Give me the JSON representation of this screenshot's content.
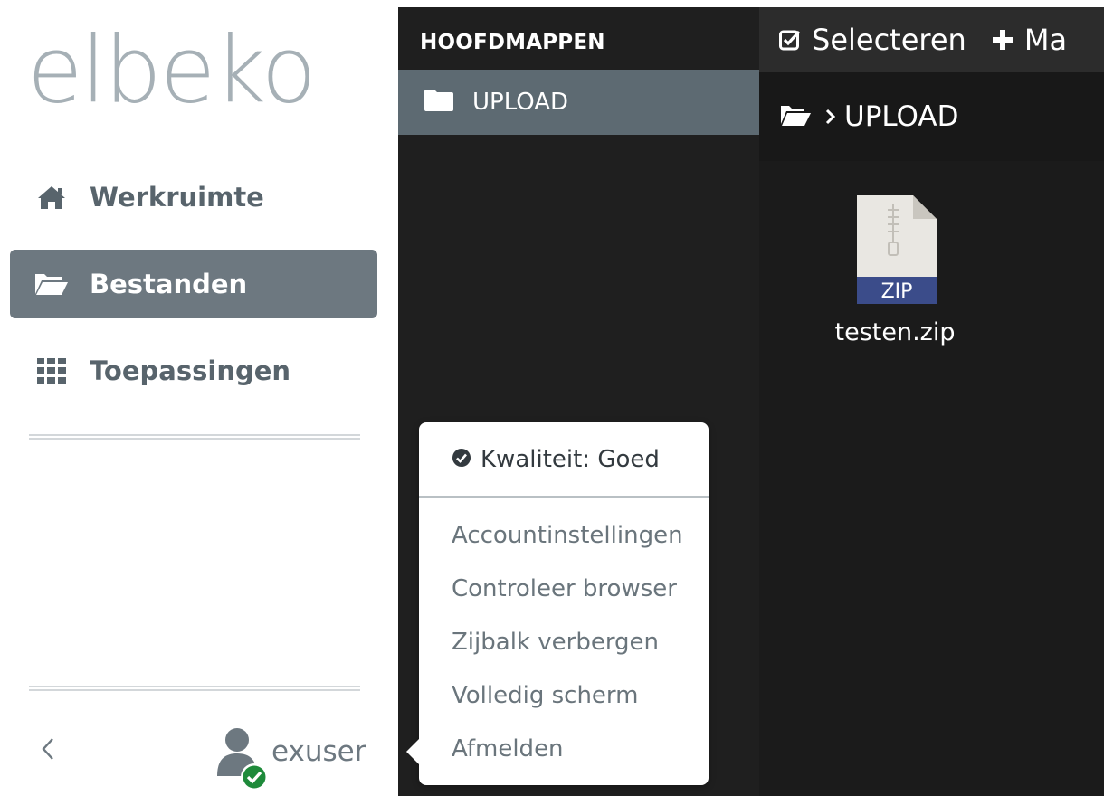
{
  "brand": {
    "logo_text": "elbeko"
  },
  "sidebar": {
    "items": [
      {
        "label": "Werkruimte",
        "icon": "home-icon",
        "active": false
      },
      {
        "label": "Bestanden",
        "icon": "folder-open-icon",
        "active": true
      },
      {
        "label": "Toepassingen",
        "icon": "grid-icon",
        "active": false
      }
    ],
    "user": {
      "name": "exuser",
      "status": "online"
    }
  },
  "folders_panel": {
    "header": "HOOFDMAPPEN",
    "items": [
      {
        "label": "UPLOAD",
        "icon": "folder-icon",
        "active": true
      }
    ]
  },
  "toolbar": {
    "select_label": "Selecteren",
    "new_label": "Ma"
  },
  "breadcrumb": {
    "current": "UPLOAD"
  },
  "files": [
    {
      "name": "testen.zip",
      "type_label": "ZIP"
    }
  ],
  "user_menu": {
    "quality": "Kwaliteit: Goed",
    "items": [
      "Accountinstellingen",
      "Controleer browser",
      "Zijbalk verbergen",
      "Volledig scherm",
      "Afmelden"
    ]
  },
  "colors": {
    "sidebar_active": "#6d7880",
    "folder_active": "#5d6a72",
    "dark_panel": "#1f1f1f",
    "status_green": "#1e8a3a"
  }
}
